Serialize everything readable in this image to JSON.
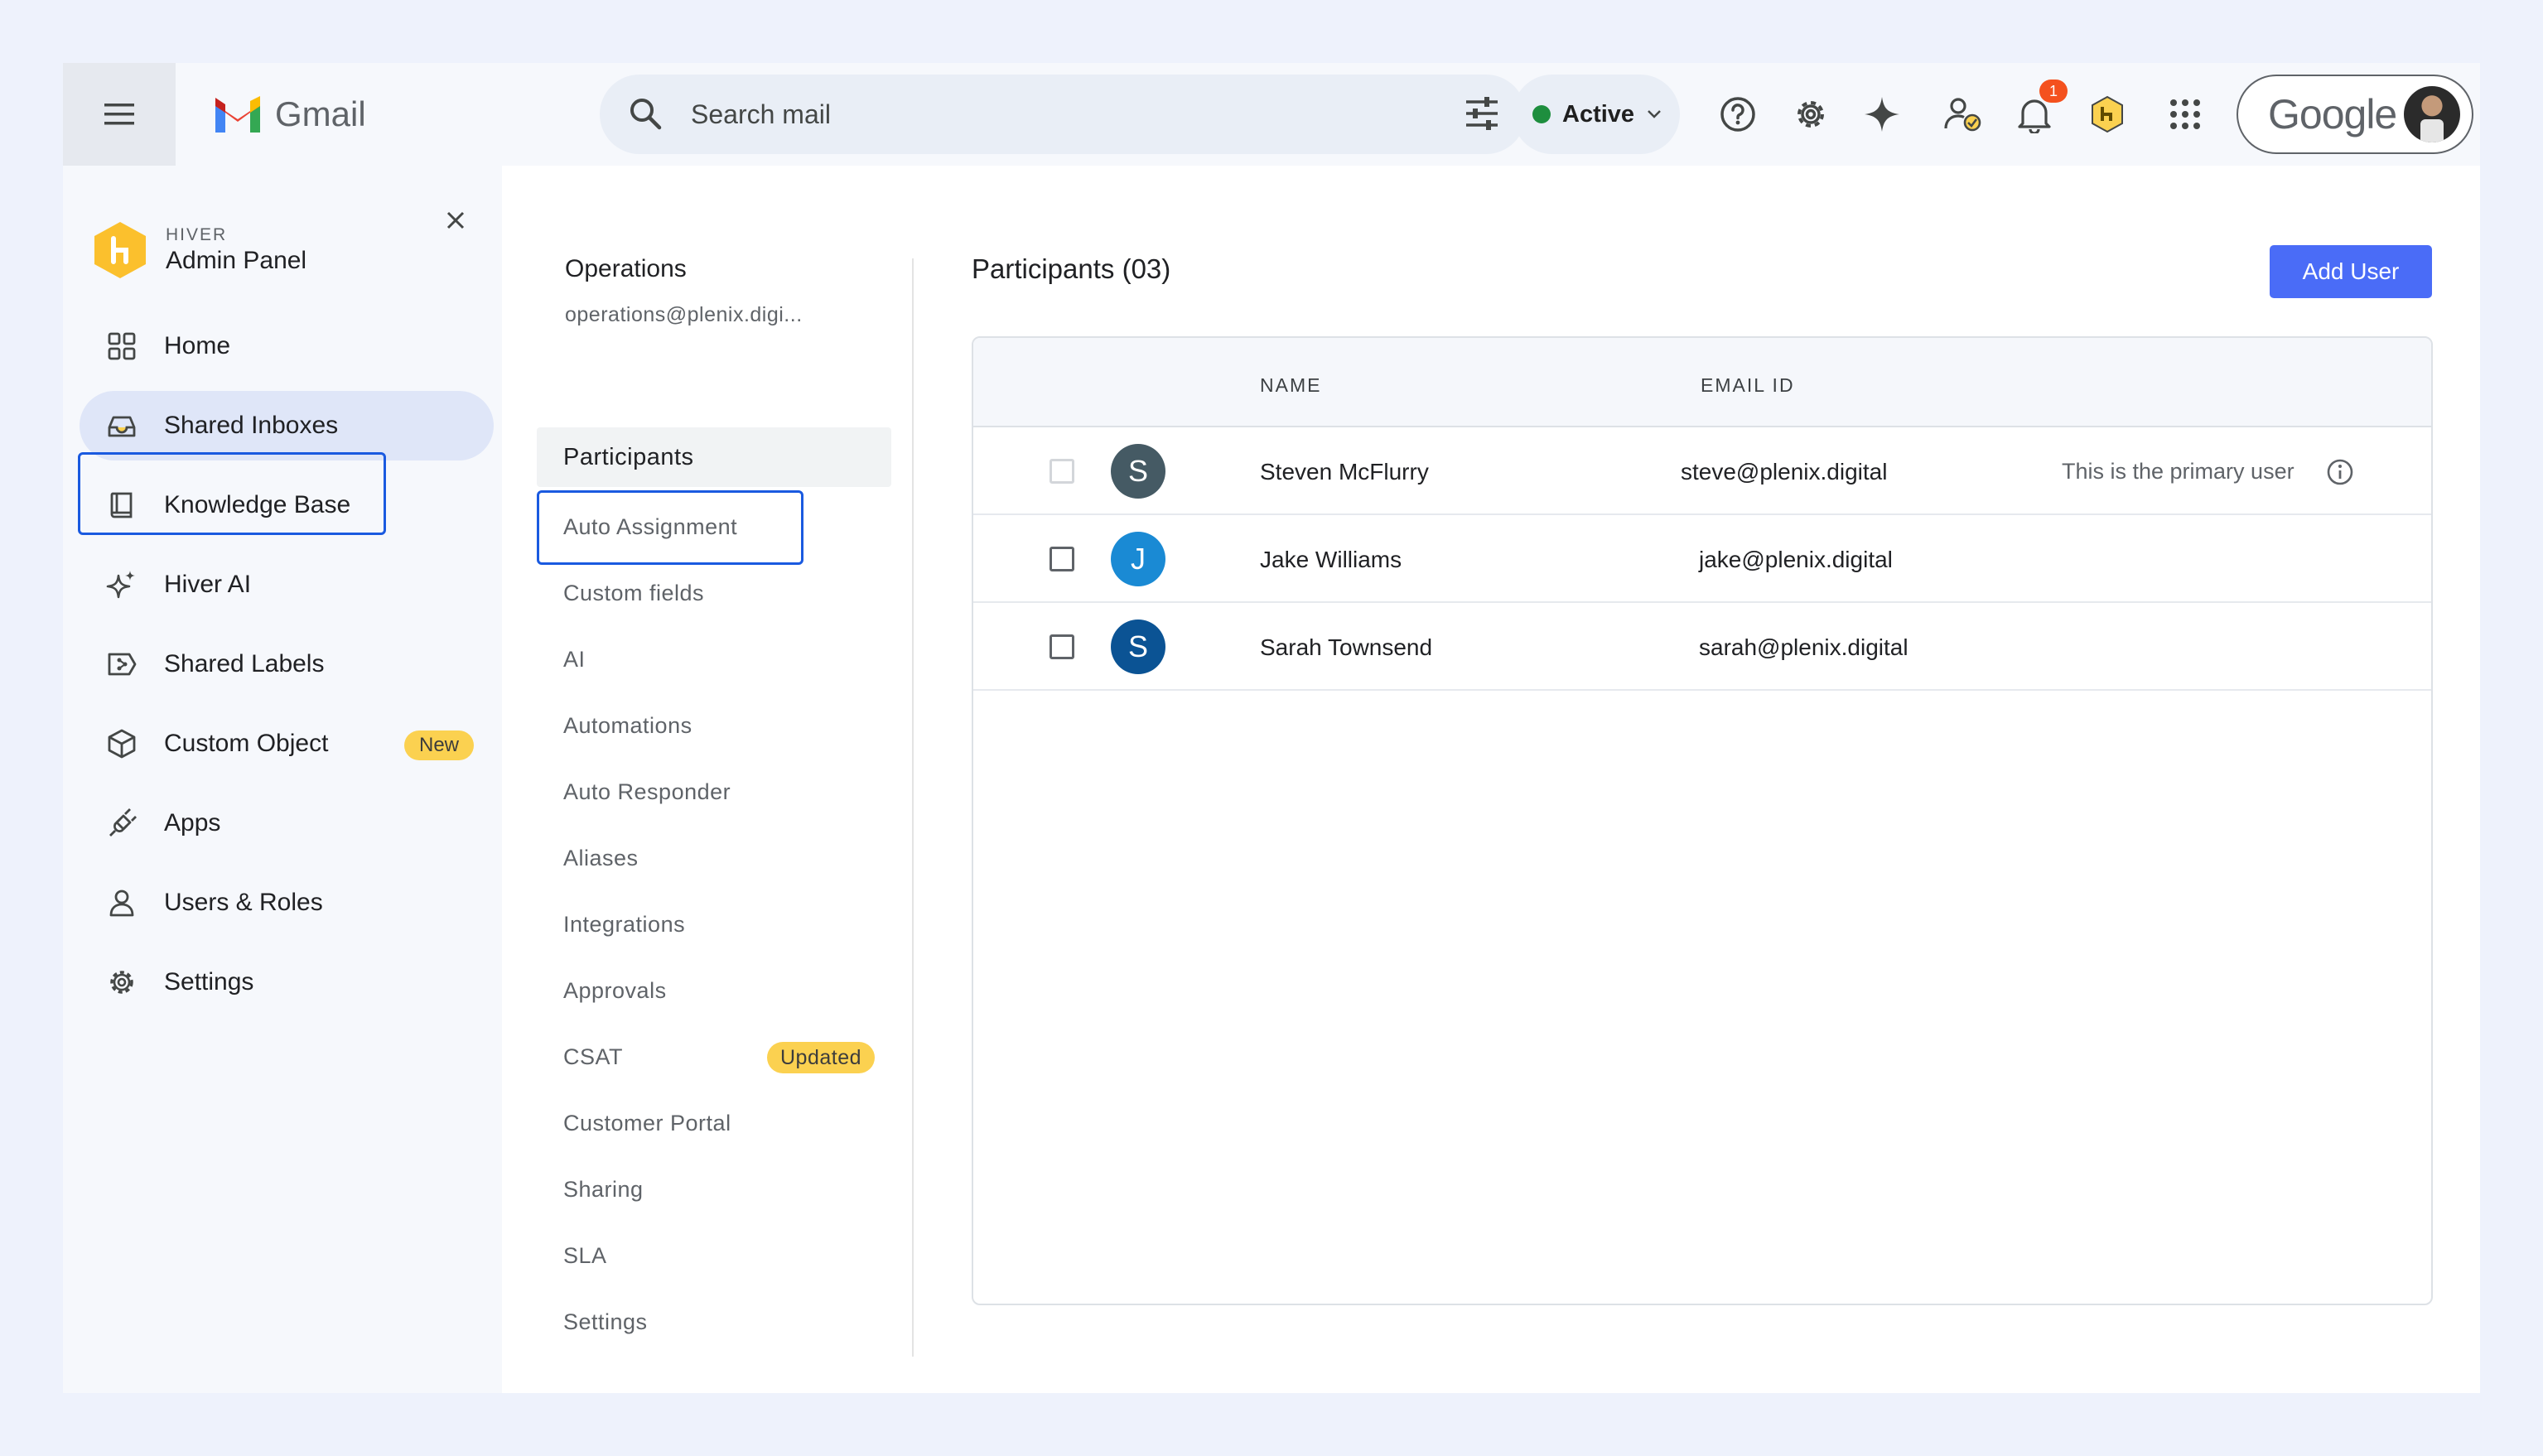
{
  "gmail": {
    "app_name": "Gmail",
    "search_placeholder": "Search mail",
    "status": {
      "label": "Active",
      "color": "#1e8e3e"
    },
    "notification_count": "1",
    "account_label": "Google"
  },
  "sidebar": {
    "brand_small": "HIVER",
    "brand_title": "Admin Panel",
    "items": [
      {
        "label": "Home",
        "icon": "grid-icon"
      },
      {
        "label": "Shared Inboxes",
        "icon": "inbox-icon",
        "active": true
      },
      {
        "label": "Knowledge Base",
        "icon": "book-icon"
      },
      {
        "label": "Hiver AI",
        "icon": "sparkle-icon"
      },
      {
        "label": "Shared Labels",
        "icon": "label-icon"
      },
      {
        "label": "Custom Object",
        "icon": "cube-icon",
        "badge": "New"
      },
      {
        "label": "Apps",
        "icon": "plug-icon"
      },
      {
        "label": "Users & Roles",
        "icon": "person-icon"
      },
      {
        "label": "Settings",
        "icon": "gear-icon"
      }
    ]
  },
  "subnav": {
    "inbox_name": "Operations",
    "inbox_email": "operations@plenix.digi...",
    "items": [
      {
        "label": "Participants",
        "active": true
      },
      {
        "label": "Auto Assignment"
      },
      {
        "label": "Custom fields"
      },
      {
        "label": "AI"
      },
      {
        "label": "Automations"
      },
      {
        "label": "Auto Responder"
      },
      {
        "label": "Aliases"
      },
      {
        "label": "Integrations"
      },
      {
        "label": "Approvals"
      },
      {
        "label": "CSAT",
        "badge": "Updated"
      },
      {
        "label": "Customer Portal"
      },
      {
        "label": "Sharing"
      },
      {
        "label": "SLA"
      },
      {
        "label": "Settings"
      }
    ]
  },
  "main": {
    "title": "Participants (03)",
    "add_user_label": "Add User",
    "columns": [
      "NAME",
      "EMAIL ID"
    ],
    "rows": [
      {
        "initial": "S",
        "name": "Steven McFlurry",
        "email": "steve@plenix.digital",
        "note": "This is the primary user",
        "avatar_color": "#455a64"
      },
      {
        "initial": "J",
        "name": "Jake Williams",
        "email": "jake@plenix.digital",
        "note": "",
        "avatar_color": "#1a8ad4"
      },
      {
        "initial": "S",
        "name": "Sarah Townsend",
        "email": "sarah@plenix.digital",
        "note": "",
        "avatar_color": "#0b5394"
      }
    ]
  }
}
